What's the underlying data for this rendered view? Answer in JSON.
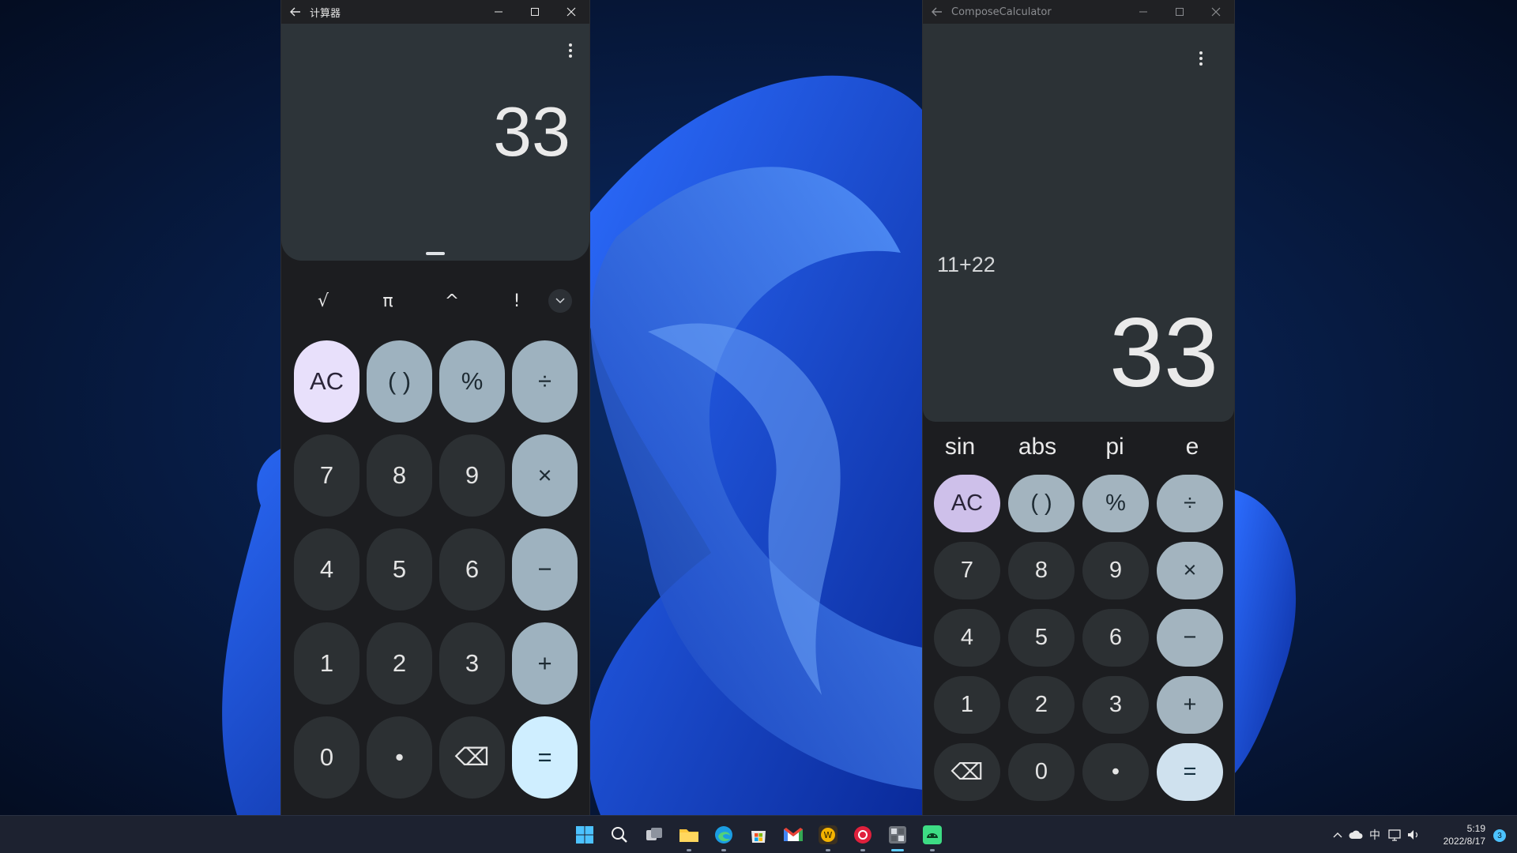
{
  "calc1": {
    "title": "计算器",
    "result": "33",
    "sci_keys": [
      "√",
      "π",
      "^",
      "!"
    ],
    "keys": [
      {
        "label": "AC",
        "kind": "ac",
        "name": "clear-button"
      },
      {
        "label": "( )",
        "kind": "op",
        "name": "parentheses-button"
      },
      {
        "label": "%",
        "kind": "op",
        "name": "percent-button"
      },
      {
        "label": "÷",
        "kind": "op",
        "name": "divide-button"
      },
      {
        "label": "7",
        "kind": "num",
        "name": "digit-7-button"
      },
      {
        "label": "8",
        "kind": "num",
        "name": "digit-8-button"
      },
      {
        "label": "9",
        "kind": "num",
        "name": "digit-9-button"
      },
      {
        "label": "×",
        "kind": "op",
        "name": "multiply-button"
      },
      {
        "label": "4",
        "kind": "num",
        "name": "digit-4-button"
      },
      {
        "label": "5",
        "kind": "num",
        "name": "digit-5-button"
      },
      {
        "label": "6",
        "kind": "num",
        "name": "digit-6-button"
      },
      {
        "label": "−",
        "kind": "op",
        "name": "minus-button"
      },
      {
        "label": "1",
        "kind": "num",
        "name": "digit-1-button"
      },
      {
        "label": "2",
        "kind": "num",
        "name": "digit-2-button"
      },
      {
        "label": "3",
        "kind": "num",
        "name": "digit-3-button"
      },
      {
        "label": "+",
        "kind": "op",
        "name": "plus-button"
      },
      {
        "label": "0",
        "kind": "num",
        "name": "digit-0-button"
      },
      {
        "label": "•",
        "kind": "num",
        "name": "decimal-point-button"
      },
      {
        "label": "⌫",
        "kind": "num",
        "name": "backspace-button"
      },
      {
        "label": "=",
        "kind": "eq",
        "name": "equals-button"
      }
    ]
  },
  "calc2": {
    "title": "ComposeCalculator",
    "expression": "11+22",
    "result": "33",
    "sci_keys": [
      "sin",
      "abs",
      "pi",
      "e"
    ],
    "keys": [
      {
        "label": "AC",
        "kind": "ac",
        "name": "clear-button"
      },
      {
        "label": "( )",
        "kind": "op",
        "name": "parentheses-button"
      },
      {
        "label": "%",
        "kind": "op",
        "name": "percent-button"
      },
      {
        "label": "÷",
        "kind": "op",
        "name": "divide-button"
      },
      {
        "label": "7",
        "kind": "num",
        "name": "digit-7-button"
      },
      {
        "label": "8",
        "kind": "num",
        "name": "digit-8-button"
      },
      {
        "label": "9",
        "kind": "num",
        "name": "digit-9-button"
      },
      {
        "label": "×",
        "kind": "op",
        "name": "multiply-button"
      },
      {
        "label": "4",
        "kind": "num",
        "name": "digit-4-button"
      },
      {
        "label": "5",
        "kind": "num",
        "name": "digit-5-button"
      },
      {
        "label": "6",
        "kind": "num",
        "name": "digit-6-button"
      },
      {
        "label": "−",
        "kind": "op",
        "name": "minus-button"
      },
      {
        "label": "1",
        "kind": "num",
        "name": "digit-1-button"
      },
      {
        "label": "2",
        "kind": "num",
        "name": "digit-2-button"
      },
      {
        "label": "3",
        "kind": "num",
        "name": "digit-3-button"
      },
      {
        "label": "+",
        "kind": "op",
        "name": "plus-button"
      },
      {
        "label": "⌫",
        "kind": "num",
        "name": "backspace-button"
      },
      {
        "label": "0",
        "kind": "num",
        "name": "digit-0-button"
      },
      {
        "label": "•",
        "kind": "num",
        "name": "decimal-point-button"
      },
      {
        "label": "=",
        "kind": "eq",
        "name": "equals-button"
      }
    ]
  },
  "taskbar": {
    "apps": [
      {
        "name": "start-icon"
      },
      {
        "name": "search-icon"
      },
      {
        "name": "task-view-icon"
      },
      {
        "name": "file-explorer-icon"
      },
      {
        "name": "edge-browser-icon"
      },
      {
        "name": "microsoft-store-icon"
      },
      {
        "name": "gmail-icon"
      },
      {
        "name": "app-w-icon"
      },
      {
        "name": "music-app-icon"
      },
      {
        "name": "calculator-app-icon"
      },
      {
        "name": "android-app-icon"
      }
    ],
    "ime": "中",
    "time": "5:19",
    "date": "2022/8/17",
    "notification_count": "3"
  },
  "colors": {
    "accent": "#60cdff",
    "calc1_ac": "#e8e0fb",
    "calc1_op": "#9eb2bf",
    "calc1_eq": "#cfeeff",
    "calc2_ac": "#cec0ea"
  }
}
